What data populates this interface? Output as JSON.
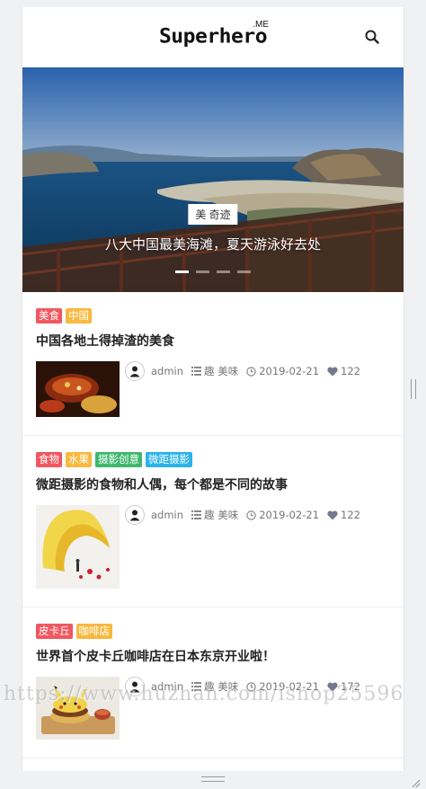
{
  "header": {
    "logo_text": "Superhero",
    "logo_sup": ".ME",
    "search_icon": "search-icon"
  },
  "banner": {
    "tag": "美 奇迹",
    "title": "八大中国最美海滩，夏天游泳好去处",
    "slide_count": 4,
    "active_slide": 1
  },
  "colors": {
    "tag_red": "#f0575f",
    "tag_orange": "#f7b93f",
    "tag_green": "#3db86c",
    "tag_blue": "#2ab3e8"
  },
  "posts": [
    {
      "tags": [
        {
          "label": "美食",
          "color": "#f0575f"
        },
        {
          "label": "中国",
          "color": "#f7b93f"
        }
      ],
      "title": "中国各地土得掉渣的美食",
      "author": "admin",
      "category": "趣 美味",
      "date": "2019-02-21",
      "likes": "122"
    },
    {
      "tags": [
        {
          "label": "食物",
          "color": "#f0575f"
        },
        {
          "label": "水果",
          "color": "#f7b93f"
        },
        {
          "label": "摄影创意",
          "color": "#3db86c"
        },
        {
          "label": "微距摄影",
          "color": "#2ab3e8"
        }
      ],
      "title": "微距摄影的食物和人偶，每个都是不同的故事",
      "author": "admin",
      "category": "趣 美味",
      "date": "2019-02-21",
      "likes": "122"
    },
    {
      "tags": [
        {
          "label": "皮卡丘",
          "color": "#f0575f"
        },
        {
          "label": "咖啡店",
          "color": "#f7b93f"
        }
      ],
      "title": "世界首个皮卡丘咖啡店在日本东京开业啦！",
      "author": "admin",
      "category": "趣 美味",
      "date": "2019-02-21",
      "likes": "172"
    }
  ],
  "watermark": "https://www.huzhan.com/ishop25596"
}
